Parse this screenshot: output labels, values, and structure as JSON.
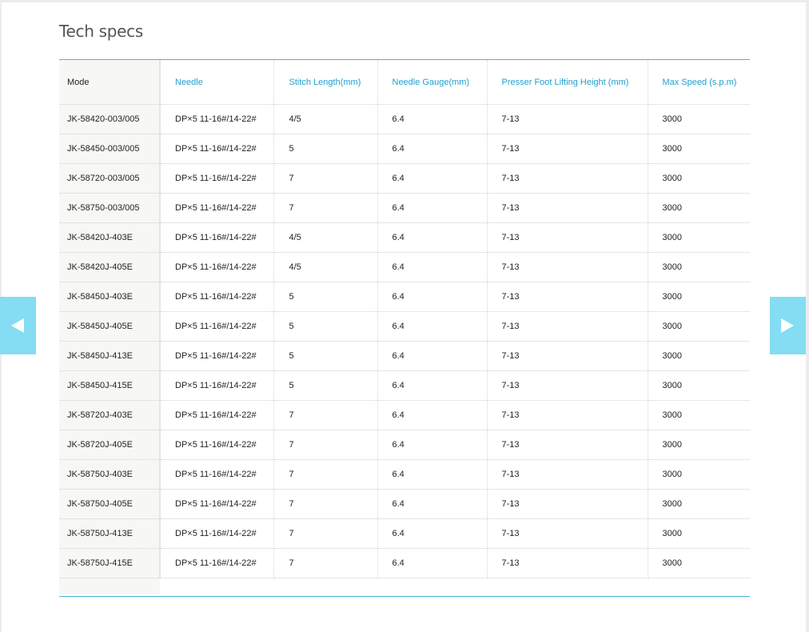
{
  "section": {
    "title": "Tech specs"
  },
  "nav": {
    "prev_icon": "triangle-left-icon",
    "next_icon": "triangle-right-icon"
  },
  "colors": {
    "accent": "#4ab3d6",
    "header_text": "#1f9fd0",
    "arrow_bg": "#84ddf2"
  },
  "table": {
    "headers": [
      "Mode",
      "Needle",
      "Stitch Length(mm)",
      "Needle Gauge(mm)",
      "Presser Foot Lifting Height (mm)",
      "Max Speed (s.p.m)"
    ],
    "rows": [
      [
        "JK-58420-003/005",
        "DP×5 11-16#/14-22#",
        "4/5",
        "6.4",
        "7-13",
        "3000"
      ],
      [
        "JK-58450-003/005",
        "DP×5 11-16#/14-22#",
        "5",
        "6.4",
        "7-13",
        "3000"
      ],
      [
        "JK-58720-003/005",
        "DP×5 11-16#/14-22#",
        "7",
        "6.4",
        "7-13",
        "3000"
      ],
      [
        "JK-58750-003/005",
        "DP×5 11-16#/14-22#",
        "7",
        "6.4",
        "7-13",
        "3000"
      ],
      [
        "JK-58420J-403E",
        "DP×5 11-16#/14-22#",
        "4/5",
        "6.4",
        "7-13",
        "3000"
      ],
      [
        "JK-58420J-405E",
        "DP×5 11-16#/14-22#",
        "4/5",
        "6.4",
        "7-13",
        "3000"
      ],
      [
        "JK-58450J-403E",
        "DP×5 11-16#/14-22#",
        "5",
        "6.4",
        "7-13",
        "3000"
      ],
      [
        "JK-58450J-405E",
        "DP×5 11-16#/14-22#",
        "5",
        "6.4",
        "7-13",
        "3000"
      ],
      [
        "JK-58450J-413E",
        "DP×5 11-16#/14-22#",
        "5",
        "6.4",
        "7-13",
        "3000"
      ],
      [
        "JK-58450J-415E",
        "DP×5 11-16#/14-22#",
        "5",
        "6.4",
        "7-13",
        "3000"
      ],
      [
        "JK-58720J-403E",
        "DP×5 11-16#/14-22#",
        "7",
        "6.4",
        "7-13",
        "3000"
      ],
      [
        "JK-58720J-405E",
        "DP×5 11-16#/14-22#",
        "7",
        "6.4",
        "7-13",
        "3000"
      ],
      [
        "JK-58750J-403E",
        "DP×5 11-16#/14-22#",
        "7",
        "6.4",
        "7-13",
        "3000"
      ],
      [
        "JK-58750J-405E",
        "DP×5 11-16#/14-22#",
        "7",
        "6.4",
        "7-13",
        "3000"
      ],
      [
        "JK-58750J-413E",
        "DP×5 11-16#/14-22#",
        "7",
        "6.4",
        "7-13",
        "3000"
      ],
      [
        "JK-58750J-415E",
        "DP×5 11-16#/14-22#",
        "7",
        "6.4",
        "7-13",
        "3000"
      ]
    ]
  }
}
